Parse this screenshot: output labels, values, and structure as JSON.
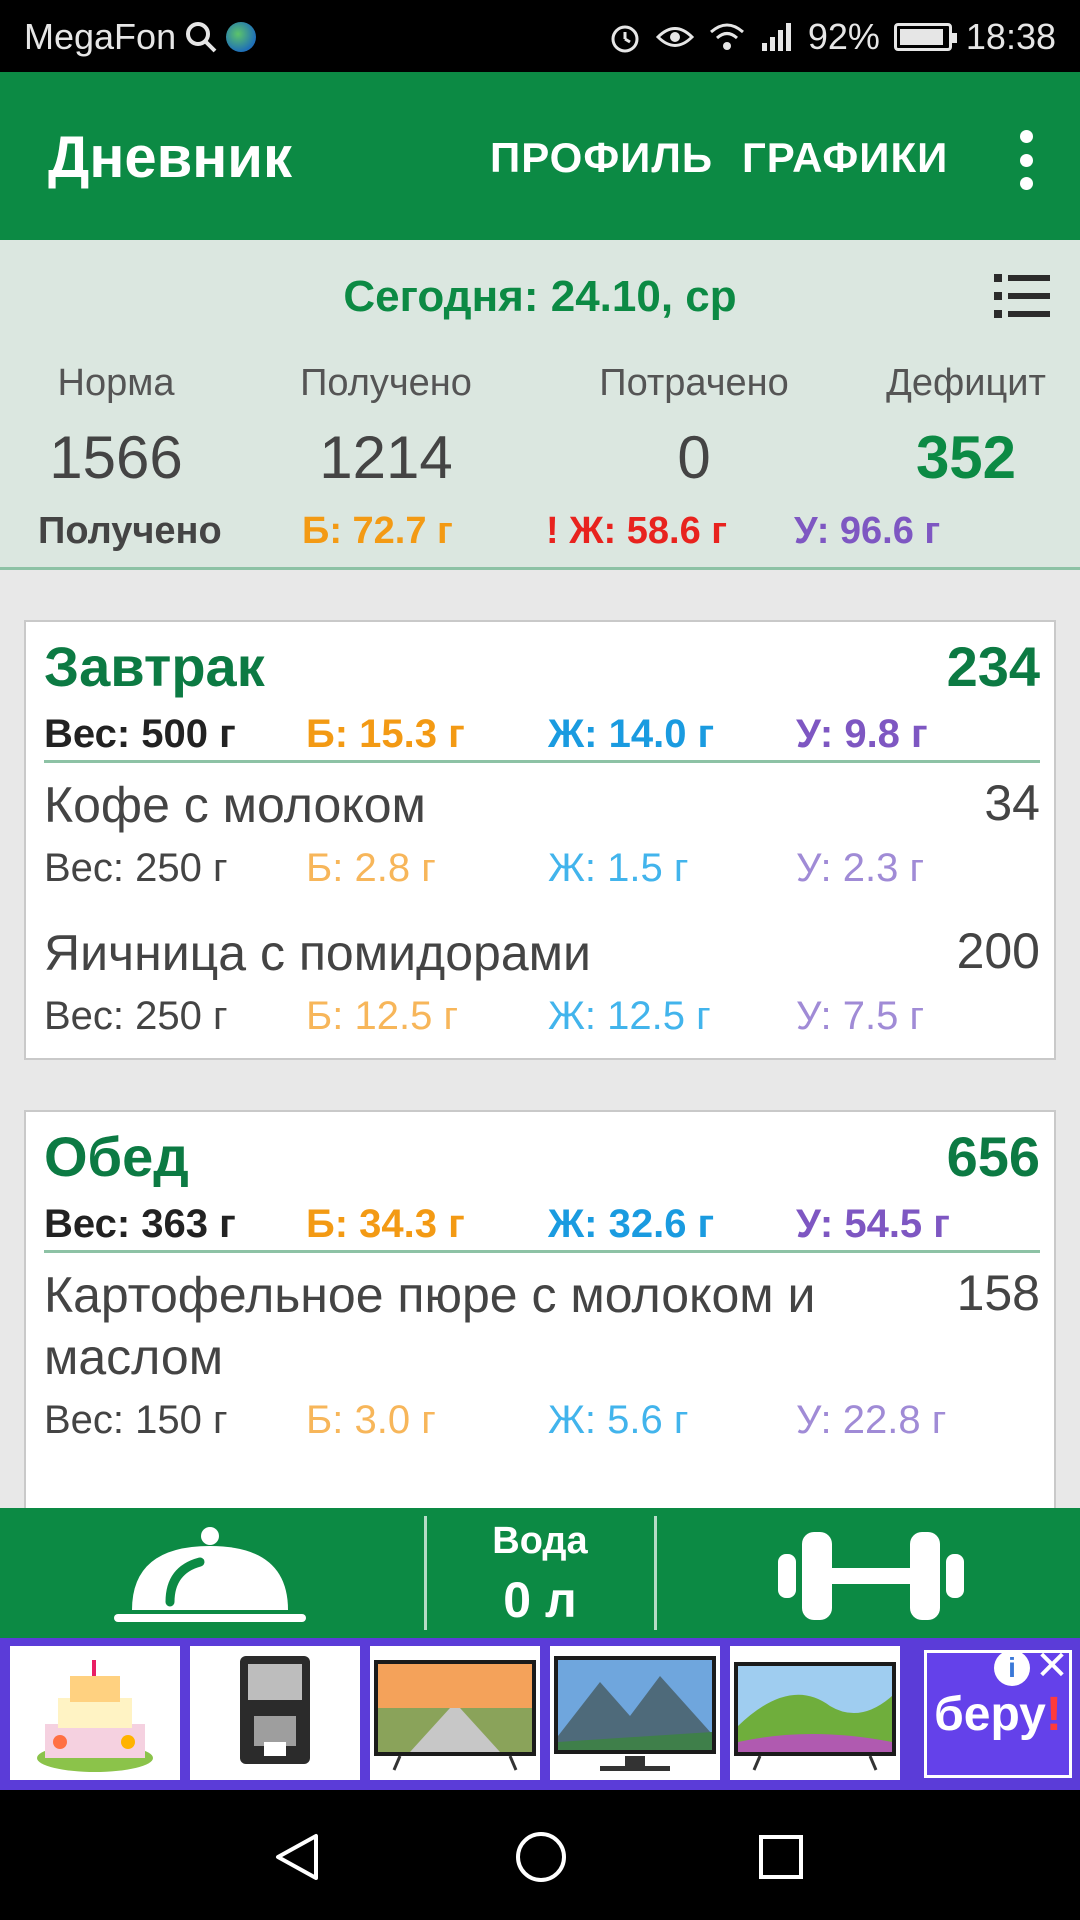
{
  "status_bar": {
    "carrier": "MegaFon",
    "battery": "92%",
    "time": "18:38"
  },
  "app_bar": {
    "title": "Дневник",
    "profile": "ПРОФИЛЬ",
    "charts": "ГРАФИКИ"
  },
  "summary": {
    "date": "Сегодня: 24.10, ср",
    "norm_label": "Норма",
    "norm_value": "1566",
    "received_label": "Получено",
    "received_value": "1214",
    "spent_label": "Потрачено",
    "spent_value": "0",
    "deficit_label": "Дефицит",
    "deficit_value": "352",
    "macros_label": "Получено",
    "protein": "Б: 72.7 г",
    "fat": "! Ж: 58.6 г",
    "carbs": "У: 96.6 г",
    "colors": {
      "protein": "#f39a14",
      "fat": "#e8231e",
      "carbs": "#7e57c2",
      "deficit": "#0c8a44"
    }
  },
  "meals": [
    {
      "name": "Завтрак",
      "kcal": "234",
      "weight": "Вес: 500 г",
      "protein": "Б: 15.3 г",
      "fat": "Ж: 14.0 г",
      "carbs": "У: 9.8 г",
      "items": [
        {
          "name": "Кофе с молоком",
          "kcal": "34",
          "weight": "Вес: 250 г",
          "protein": "Б: 2.8 г",
          "fat": "Ж: 1.5 г",
          "carbs": "У: 2.3 г"
        },
        {
          "name": "Яичница с помидорами",
          "kcal": "200",
          "weight": "Вес: 250 г",
          "protein": "Б: 12.5 г",
          "fat": "Ж: 12.5 г",
          "carbs": "У: 7.5 г"
        }
      ]
    },
    {
      "name": "Обед",
      "kcal": "656",
      "weight": "Вес: 363 г",
      "protein": "Б: 34.3 г",
      "fat": "Ж: 32.6 г",
      "carbs": "У: 54.5 г",
      "items": [
        {
          "name": "Картофельное пюре с молоком и маслом",
          "kcal": "158",
          "weight": "Вес: 150 г",
          "protein": "Б: 3.0 г",
          "fat": "Ж: 5.6 г",
          "carbs": "У: 22.8 г"
        }
      ]
    }
  ],
  "bottom_bar": {
    "water_label": "Вода",
    "water_value": "0 л"
  },
  "ad": {
    "brand": "беру",
    "brand_mark": "!",
    "info_icon": "i",
    "close_icon": "✕"
  }
}
